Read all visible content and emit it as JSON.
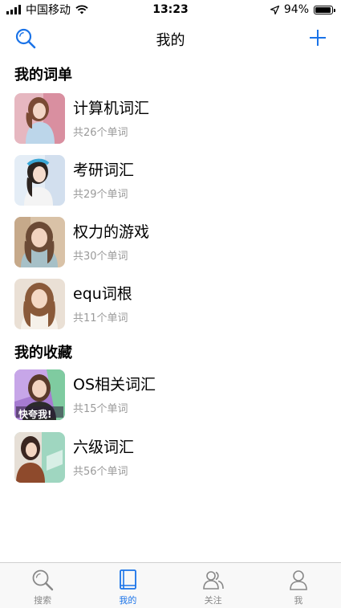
{
  "status_bar": {
    "carrier": "中国移动",
    "time": "13:23",
    "battery_percent": "94%",
    "battery_level": 0.94,
    "icons": [
      "signal-icon",
      "wifi-icon",
      "location-arrow-icon",
      "battery-icon"
    ]
  },
  "nav": {
    "title": "我的",
    "left_icon": "search-icon",
    "right_icon": "plus-icon",
    "accent_color": "#1a73e8"
  },
  "my_lists": {
    "header": "我的词单",
    "items": [
      {
        "title": "计算机词汇",
        "subtitle": "共26个单词"
      },
      {
        "title": "考研词汇",
        "subtitle": "共29个单词"
      },
      {
        "title": "权力的游戏",
        "subtitle": "共30个单词"
      },
      {
        "title": "equ词根",
        "subtitle": "共11个单词"
      }
    ]
  },
  "favorites": {
    "header": "我的收藏",
    "items": [
      {
        "title": "OS相关词汇",
        "subtitle": "共15个单词",
        "cover_text": "快夸我!"
      },
      {
        "title": "六级词汇",
        "subtitle": "共56个单词"
      }
    ]
  },
  "tab_bar": {
    "tabs": [
      {
        "label": "搜索",
        "icon": "search-icon"
      },
      {
        "label": "我的",
        "icon": "book-icon",
        "active": true
      },
      {
        "label": "关注",
        "icon": "people-icon"
      },
      {
        "label": "我",
        "icon": "person-icon"
      }
    ]
  }
}
